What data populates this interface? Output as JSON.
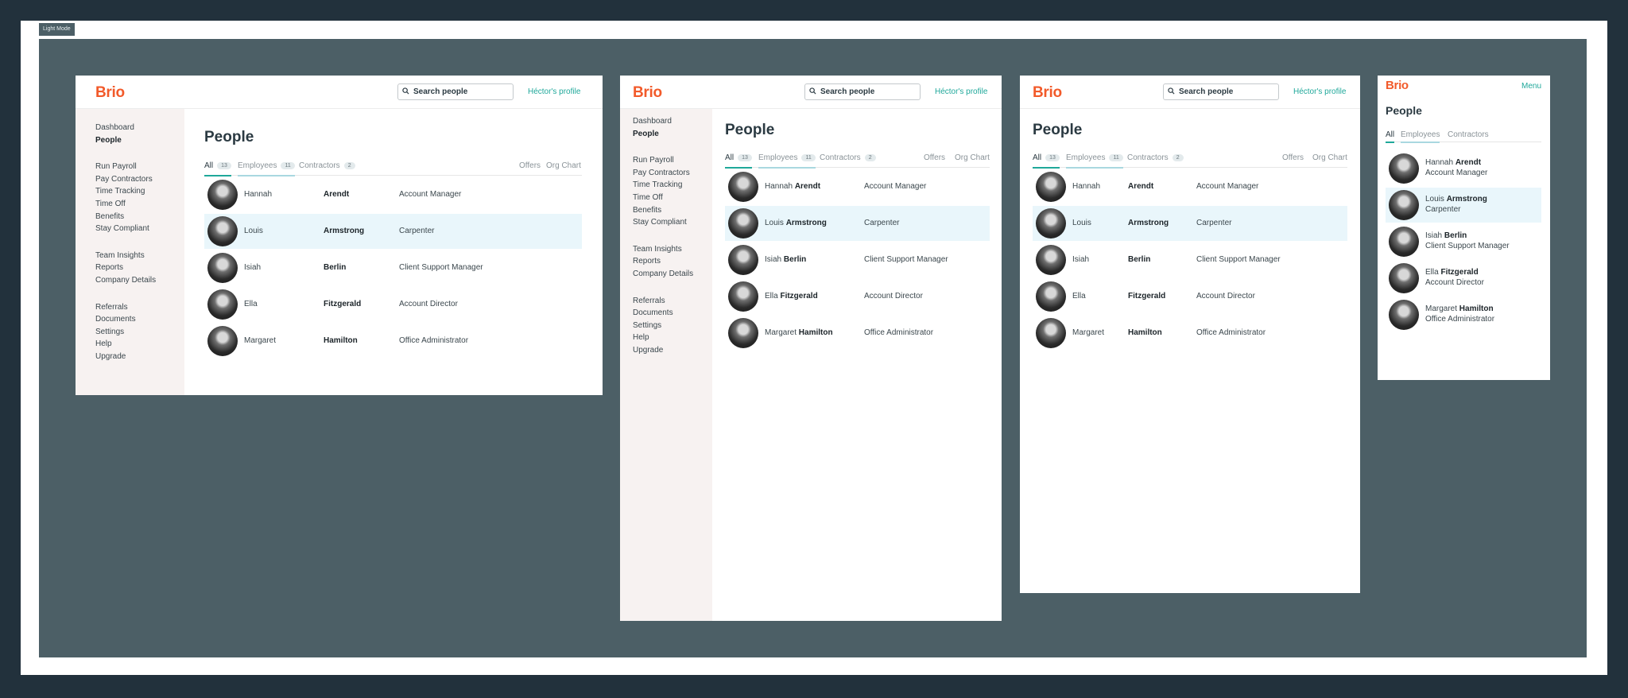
{
  "mode_button": "Light Mode",
  "brand": {
    "logo": "Brio",
    "logo_color": "#f25a2a",
    "accent_color": "#1fa89a"
  },
  "header": {
    "search_placeholder": "Search people",
    "profile_link": "Héctor's profile",
    "menu_link": "Menu"
  },
  "sidebar": {
    "groups": [
      [
        {
          "label": "Dashboard"
        },
        {
          "label": "People",
          "active": true
        }
      ],
      [
        {
          "label": "Run Payroll"
        },
        {
          "label": "Pay Contractors"
        },
        {
          "label": "Time Tracking"
        },
        {
          "label": "Time Off"
        },
        {
          "label": "Benefits"
        },
        {
          "label": "Stay Compliant"
        }
      ],
      [
        {
          "label": "Team Insights"
        },
        {
          "label": "Reports"
        },
        {
          "label": "Company Details"
        }
      ],
      [
        {
          "label": "Referrals"
        },
        {
          "label": "Documents"
        },
        {
          "label": "Settings"
        },
        {
          "label": "Help"
        },
        {
          "label": "Upgrade"
        }
      ]
    ]
  },
  "page": {
    "title": "People",
    "tabs": [
      {
        "label": "All",
        "count": "13",
        "selected": true
      },
      {
        "label": "Employees",
        "count": "11"
      },
      {
        "label": "Contractors",
        "count": "2"
      }
    ],
    "links": [
      "Offers",
      "Org Chart"
    ]
  },
  "people": [
    {
      "first": "Hannah",
      "last": "Arendt",
      "title": "Account Manager"
    },
    {
      "first": "Louis",
      "last": "Armstrong",
      "title": "Carpenter",
      "highlighted": true
    },
    {
      "first": "Isiah",
      "last": "Berlin",
      "title": "Client Support Manager"
    },
    {
      "first": "Ella",
      "last": "Fitzgerald",
      "title": "Account Director"
    },
    {
      "first": "Margaret",
      "last": "Hamilton",
      "title": "Office Administrator"
    }
  ],
  "colors": {
    "highlight_row": "#e9f6fb",
    "sidebar_bg": "#f7f2f1",
    "tab_underline_all": "#1fa89a",
    "tab_underline_employees": "#a9d8e0",
    "canvas_bg": "#4c5f66"
  }
}
